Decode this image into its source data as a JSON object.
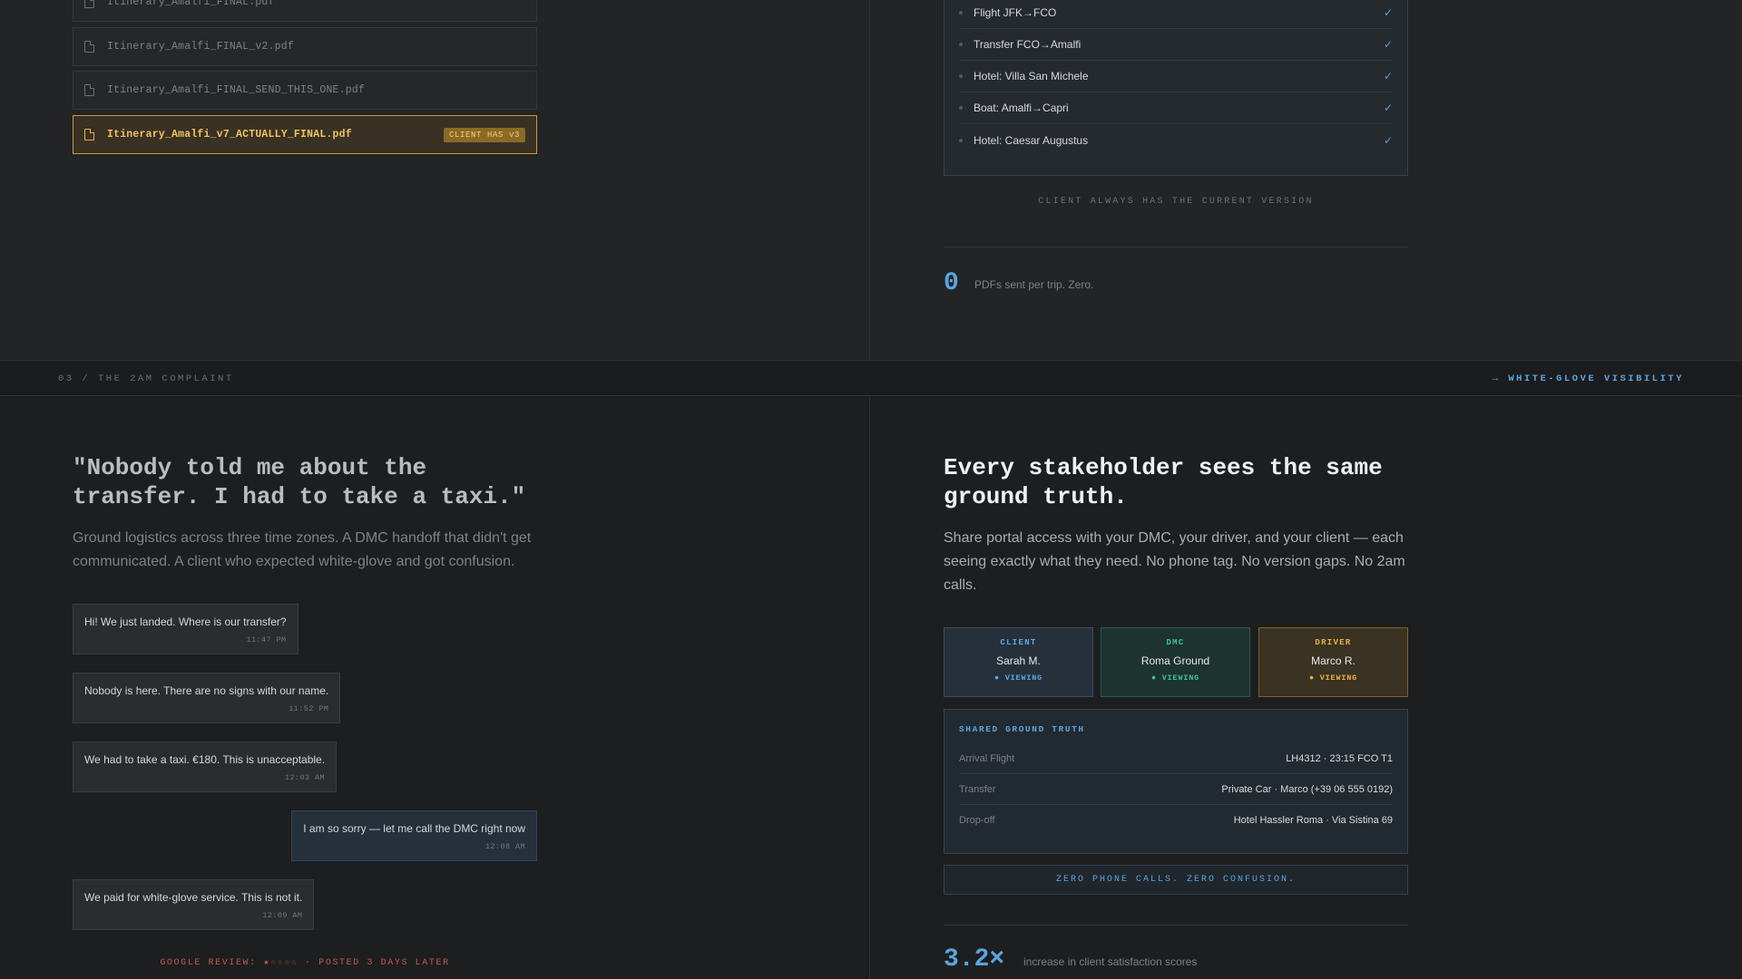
{
  "files": [
    {
      "name": "Itinerary_Amalfi_FINAL.pdf"
    },
    {
      "name": "Itinerary_Amalfi_FINAL_v2.pdf"
    },
    {
      "name": "Itinerary_Amalfi_FINAL_SEND_THIS_ONE.pdf"
    },
    {
      "name": "Itinerary_Amalfi_v7_ACTUALLY_FINAL.pdf",
      "badge": "CLIENT HAS v3"
    }
  ],
  "itinerary": {
    "items": [
      {
        "label": "Flight JFK→FCO",
        "check": "✓"
      },
      {
        "label": "Transfer FCO→Amalfi",
        "check": "✓"
      },
      {
        "label": "Hotel: Villa San Michele",
        "check": "✓"
      },
      {
        "label": "Boat: Amalfi→Capri",
        "check": "✓"
      },
      {
        "label": "Hotel: Caesar Augustus",
        "check": "✓"
      }
    ],
    "caption": "CLIENT ALWAYS HAS THE CURRENT VERSION",
    "stat_value": "0",
    "stat_text": "PDFs sent per trip. Zero."
  },
  "section": {
    "label": "03 / THE 2AM COMPLAINT",
    "right_label": "→ WHITE-GLOVE VISIBILITY"
  },
  "problem": {
    "quote": "\"Nobody told me about the transfer. I had to take a taxi.\"",
    "lead": "Ground logistics across three time zones. A DMC handoff that didn't get communicated. A client who expected white-glove and got confusion.",
    "messages": [
      {
        "text": "Hi! We just landed. Where is our transfer?",
        "time": "11:47 PM"
      },
      {
        "text": "Nobody is here. There are no signs with our name.",
        "time": "11:52 PM"
      },
      {
        "text": "We had to take a taxi. €180. This is unacceptable.",
        "time": "12:03 AM"
      },
      {
        "text": "I am so sorry — let me call the DMC right now",
        "time": "12:08 AM"
      },
      {
        "text": "We paid for white-glove service. This is not it.",
        "time": "12:09 AM"
      }
    ],
    "review": "GOOGLE REVIEW: ★☆☆☆☆ · POSTED 3 DAYS LATER"
  },
  "solution": {
    "heading": "Every stakeholder sees the same ground truth.",
    "lead": "Share portal access with your DMC, your driver, and your client — each seeing exactly what they need. No phone tag. No version gaps. No 2am calls.",
    "stakeholders": [
      {
        "role": "CLIENT",
        "name": "Sarah M.",
        "status": "● VIEWING"
      },
      {
        "role": "DMC",
        "name": "Roma Ground",
        "status": "● VIEWING"
      },
      {
        "role": "DRIVER",
        "name": "Marco R.",
        "status": "● VIEWING"
      }
    ],
    "truth": {
      "title": "SHARED GROUND TRUTH",
      "rows": [
        {
          "key": "Arrival Flight",
          "value": "LH4312 · 23:15 FCO T1"
        },
        {
          "key": "Transfer",
          "value": "Private Car · Marco (+39 06 555 0192)"
        },
        {
          "key": "Drop-off",
          "value": "Hotel Hassler Roma · Via Sistina 69"
        }
      ]
    },
    "zero_bar": "ZERO PHONE CALLS. ZERO CONFUSION.",
    "stat_value": "3.2×",
    "stat_text": "increase in client satisfaction scores"
  }
}
